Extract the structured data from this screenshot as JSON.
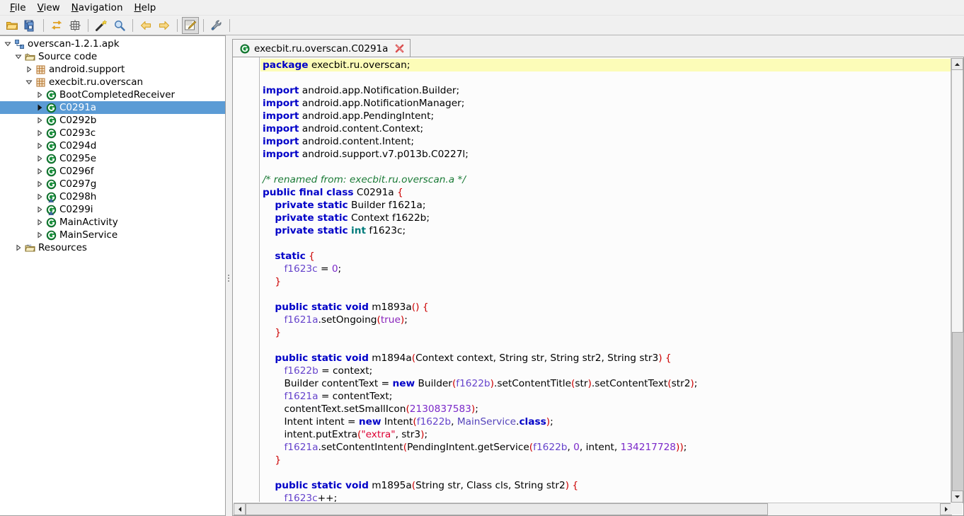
{
  "window": {
    "title": "overscan-1.2.1.apk"
  },
  "menubar": {
    "items": [
      {
        "mnemonic": "F",
        "rest": "ile",
        "name": "menu-file"
      },
      {
        "mnemonic": "V",
        "rest": "iew",
        "name": "menu-view"
      },
      {
        "mnemonic": "N",
        "rest": "avigation",
        "name": "menu-navigation"
      },
      {
        "mnemonic": "H",
        "rest": "elp",
        "name": "menu-help"
      }
    ]
  },
  "toolbar": {
    "buttons": [
      {
        "icon": "open-folder-icon",
        "active": false
      },
      {
        "icon": "save-all-icon",
        "active": false
      },
      {
        "sep": true
      },
      {
        "icon": "sort-arrows-icon",
        "active": false
      },
      {
        "icon": "grid-icon",
        "active": false
      },
      {
        "sep": true
      },
      {
        "icon": "magic-wand-icon",
        "active": false
      },
      {
        "icon": "search-magnifier-icon",
        "active": false
      },
      {
        "sep": true
      },
      {
        "icon": "back-arrow-icon",
        "active": false
      },
      {
        "icon": "forward-arrow-icon",
        "active": false
      },
      {
        "sep": true
      },
      {
        "icon": "edit-pencil-icon",
        "active": true
      },
      {
        "sep": true
      },
      {
        "icon": "wrench-icon",
        "active": false
      },
      {
        "sep": true
      }
    ]
  },
  "tree": {
    "items": [
      {
        "label": "overscan-1.2.1.apk",
        "indent": 0,
        "twisty": "open",
        "icon": "apk-icon",
        "selected": false
      },
      {
        "label": "Source code",
        "indent": 1,
        "twisty": "open",
        "icon": "sources-icon",
        "selected": false
      },
      {
        "label": "android.support",
        "indent": 2,
        "twisty": "closed",
        "icon": "package-icon",
        "selected": false
      },
      {
        "label": "execbit.ru.overscan",
        "indent": 2,
        "twisty": "open",
        "icon": "package-icon",
        "selected": false
      },
      {
        "label": "BootCompletedReceiver",
        "indent": 3,
        "twisty": "closed",
        "icon": "class-icon",
        "selected": false
      },
      {
        "label": "C0291a",
        "indent": 3,
        "twisty": "closed",
        "icon": "class-icon",
        "selected": true
      },
      {
        "label": "C0292b",
        "indent": 3,
        "twisty": "closed",
        "icon": "class-icon",
        "selected": false
      },
      {
        "label": "C0293c",
        "indent": 3,
        "twisty": "closed",
        "icon": "class-icon",
        "selected": false
      },
      {
        "label": "C0294d",
        "indent": 3,
        "twisty": "closed",
        "icon": "class-icon",
        "selected": false
      },
      {
        "label": "C0295e",
        "indent": 3,
        "twisty": "closed",
        "icon": "class-icon",
        "selected": false
      },
      {
        "label": "C0296f",
        "indent": 3,
        "twisty": "closed",
        "icon": "class-icon",
        "selected": false
      },
      {
        "label": "C0297g",
        "indent": 3,
        "twisty": "closed",
        "icon": "class-icon",
        "selected": false
      },
      {
        "label": "C0298h",
        "indent": 3,
        "twisty": "closed",
        "icon": "inner-class-icon",
        "selected": false
      },
      {
        "label": "C0299i",
        "indent": 3,
        "twisty": "closed",
        "icon": "inner-class-icon",
        "selected": false
      },
      {
        "label": "MainActivity",
        "indent": 3,
        "twisty": "closed",
        "icon": "class-icon",
        "selected": false
      },
      {
        "label": "MainService",
        "indent": 3,
        "twisty": "closed",
        "icon": "class-icon",
        "selected": false
      },
      {
        "label": "Resources",
        "indent": 1,
        "twisty": "closed",
        "icon": "resources-icon",
        "selected": false
      }
    ]
  },
  "editor": {
    "tab": {
      "label": "execbit.ru.overscan.C0291a",
      "icon": "class-icon",
      "close_icon": "close-x-icon"
    },
    "lines": [
      {
        "highlight": true,
        "tokens": [
          {
            "t": "package",
            "c": "kw"
          },
          {
            "t": " execbit.ru.overscan;",
            "c": ""
          }
        ]
      },
      {
        "tokens": []
      },
      {
        "tokens": [
          {
            "t": "import",
            "c": "kw"
          },
          {
            "t": " android.app.Notification.Builder;",
            "c": ""
          }
        ]
      },
      {
        "tokens": [
          {
            "t": "import",
            "c": "kw"
          },
          {
            "t": " android.app.NotificationManager;",
            "c": ""
          }
        ]
      },
      {
        "tokens": [
          {
            "t": "import",
            "c": "kw"
          },
          {
            "t": " android.app.PendingIntent;",
            "c": ""
          }
        ]
      },
      {
        "tokens": [
          {
            "t": "import",
            "c": "kw"
          },
          {
            "t": " android.content.Context;",
            "c": ""
          }
        ]
      },
      {
        "tokens": [
          {
            "t": "import",
            "c": "kw"
          },
          {
            "t": " android.content.Intent;",
            "c": ""
          }
        ]
      },
      {
        "tokens": [
          {
            "t": "import",
            "c": "kw"
          },
          {
            "t": " android.support.v7.p013b.C0227l;",
            "c": ""
          }
        ]
      },
      {
        "tokens": []
      },
      {
        "tokens": [
          {
            "t": "/* renamed from: execbit.ru.overscan.a */",
            "c": "cmt"
          }
        ]
      },
      {
        "tokens": [
          {
            "t": "public final class",
            "c": "kw"
          },
          {
            "t": " C0291a ",
            "c": ""
          },
          {
            "t": "{",
            "c": "pnc"
          }
        ]
      },
      {
        "tokens": [
          {
            "t": "    ",
            "c": ""
          },
          {
            "t": "private static",
            "c": "kw"
          },
          {
            "t": " Builder f1621a;",
            "c": ""
          }
        ]
      },
      {
        "tokens": [
          {
            "t": "    ",
            "c": ""
          },
          {
            "t": "private static",
            "c": "kw"
          },
          {
            "t": " Context f1622b;",
            "c": ""
          }
        ]
      },
      {
        "tokens": [
          {
            "t": "    ",
            "c": ""
          },
          {
            "t": "private static",
            "c": "kw"
          },
          {
            "t": " ",
            "c": ""
          },
          {
            "t": "int",
            "c": "typ"
          },
          {
            "t": " f1623c;",
            "c": ""
          }
        ]
      },
      {
        "tokens": []
      },
      {
        "tokens": [
          {
            "t": "    ",
            "c": ""
          },
          {
            "t": "static",
            "c": "kw"
          },
          {
            "t": " ",
            "c": ""
          },
          {
            "t": "{",
            "c": "pnc"
          }
        ]
      },
      {
        "tokens": [
          {
            "t": "       ",
            "c": ""
          },
          {
            "t": "f1623c",
            "c": "fld"
          },
          {
            "t": " = ",
            "c": ""
          },
          {
            "t": "0",
            "c": "num"
          },
          {
            "t": ";",
            "c": ""
          }
        ]
      },
      {
        "tokens": [
          {
            "t": "    ",
            "c": ""
          },
          {
            "t": "}",
            "c": "pnc"
          }
        ]
      },
      {
        "tokens": []
      },
      {
        "tokens": [
          {
            "t": "    ",
            "c": ""
          },
          {
            "t": "public static void",
            "c": "kw"
          },
          {
            "t": " m1893a",
            "c": ""
          },
          {
            "t": "()",
            "c": "pnc"
          },
          {
            "t": " ",
            "c": ""
          },
          {
            "t": "{",
            "c": "pnc"
          }
        ]
      },
      {
        "tokens": [
          {
            "t": "       ",
            "c": ""
          },
          {
            "t": "f1621a",
            "c": "fld"
          },
          {
            "t": ".setOngoing",
            "c": ""
          },
          {
            "t": "(",
            "c": "pnc"
          },
          {
            "t": "true",
            "c": "lit"
          },
          {
            "t": ")",
            "c": "pnc"
          },
          {
            "t": ";",
            "c": ""
          }
        ]
      },
      {
        "tokens": [
          {
            "t": "    ",
            "c": ""
          },
          {
            "t": "}",
            "c": "pnc"
          }
        ]
      },
      {
        "tokens": []
      },
      {
        "tokens": [
          {
            "t": "    ",
            "c": ""
          },
          {
            "t": "public static void",
            "c": "kw"
          },
          {
            "t": " m1894a",
            "c": ""
          },
          {
            "t": "(",
            "c": "pnc"
          },
          {
            "t": "Context context, String str, String str2, String str3",
            "c": ""
          },
          {
            "t": ")",
            "c": "pnc"
          },
          {
            "t": " ",
            "c": ""
          },
          {
            "t": "{",
            "c": "pnc"
          }
        ]
      },
      {
        "tokens": [
          {
            "t": "       ",
            "c": ""
          },
          {
            "t": "f1622b",
            "c": "fld"
          },
          {
            "t": " = context;",
            "c": ""
          }
        ]
      },
      {
        "tokens": [
          {
            "t": "       Builder contentText = ",
            "c": ""
          },
          {
            "t": "new",
            "c": "kw"
          },
          {
            "t": " Builder",
            "c": ""
          },
          {
            "t": "(",
            "c": "pnc"
          },
          {
            "t": "f1622b",
            "c": "fld"
          },
          {
            "t": ")",
            "c": "pnc"
          },
          {
            "t": ".setContentTitle",
            "c": ""
          },
          {
            "t": "(",
            "c": "pnc"
          },
          {
            "t": "str",
            "c": ""
          },
          {
            "t": ")",
            "c": "pnc"
          },
          {
            "t": ".setContentText",
            "c": ""
          },
          {
            "t": "(",
            "c": "pnc"
          },
          {
            "t": "str2",
            "c": ""
          },
          {
            "t": ")",
            "c": "pnc"
          },
          {
            "t": ";",
            "c": ""
          }
        ]
      },
      {
        "tokens": [
          {
            "t": "       ",
            "c": ""
          },
          {
            "t": "f1621a",
            "c": "fld"
          },
          {
            "t": " = contentText;",
            "c": ""
          }
        ]
      },
      {
        "tokens": [
          {
            "t": "       contentText.setSmallIcon",
            "c": ""
          },
          {
            "t": "(",
            "c": "pnc"
          },
          {
            "t": "2130837583",
            "c": "num"
          },
          {
            "t": ")",
            "c": "pnc"
          },
          {
            "t": ";",
            "c": ""
          }
        ]
      },
      {
        "tokens": [
          {
            "t": "       Intent intent = ",
            "c": ""
          },
          {
            "t": "new",
            "c": "kw"
          },
          {
            "t": " Intent",
            "c": ""
          },
          {
            "t": "(",
            "c": "pnc"
          },
          {
            "t": "f1622b",
            "c": "fld"
          },
          {
            "t": ", ",
            "c": ""
          },
          {
            "t": "MainService",
            "c": "cls2"
          },
          {
            "t": ".",
            "c": ""
          },
          {
            "t": "class",
            "c": "kw"
          },
          {
            "t": ")",
            "c": "pnc"
          },
          {
            "t": ";",
            "c": ""
          }
        ]
      },
      {
        "tokens": [
          {
            "t": "       intent.putExtra",
            "c": ""
          },
          {
            "t": "(",
            "c": "pnc"
          },
          {
            "t": "\"extra\"",
            "c": "str"
          },
          {
            "t": ", str3",
            "c": ""
          },
          {
            "t": ")",
            "c": "pnc"
          },
          {
            "t": ";",
            "c": ""
          }
        ]
      },
      {
        "tokens": [
          {
            "t": "       ",
            "c": ""
          },
          {
            "t": "f1621a",
            "c": "fld"
          },
          {
            "t": ".setContentIntent",
            "c": ""
          },
          {
            "t": "(",
            "c": "pnc"
          },
          {
            "t": "PendingIntent.getService",
            "c": ""
          },
          {
            "t": "(",
            "c": "pnc"
          },
          {
            "t": "f1622b",
            "c": "fld"
          },
          {
            "t": ", ",
            "c": ""
          },
          {
            "t": "0",
            "c": "num"
          },
          {
            "t": ", intent, ",
            "c": ""
          },
          {
            "t": "134217728",
            "c": "num"
          },
          {
            "t": "))",
            "c": "pnc"
          },
          {
            "t": ";",
            "c": ""
          }
        ]
      },
      {
        "tokens": [
          {
            "t": "    ",
            "c": ""
          },
          {
            "t": "}",
            "c": "pnc"
          }
        ]
      },
      {
        "tokens": []
      },
      {
        "tokens": [
          {
            "t": "    ",
            "c": ""
          },
          {
            "t": "public static void",
            "c": "kw"
          },
          {
            "t": " m1895a",
            "c": ""
          },
          {
            "t": "(",
            "c": "pnc"
          },
          {
            "t": "String str, Class cls, String str2",
            "c": ""
          },
          {
            "t": ")",
            "c": "pnc"
          },
          {
            "t": " ",
            "c": ""
          },
          {
            "t": "{",
            "c": "pnc"
          }
        ]
      },
      {
        "tokens": [
          {
            "t": "       ",
            "c": ""
          },
          {
            "t": "f1623c",
            "c": "fld"
          },
          {
            "t": "++;",
            "c": ""
          }
        ]
      }
    ]
  },
  "scrollbars": {
    "vertical": {
      "up_icon": "scroll-up-icon",
      "down_icon": "scroll-down-icon"
    },
    "horizontal": {
      "left_icon": "scroll-left-icon",
      "right_icon": "scroll-right-icon"
    }
  },
  "colors": {
    "selection": "#5b9bd5",
    "highlight_line": "#fcfcb8",
    "keyword": "#0000c8",
    "comment": "#1a7a36",
    "string": "#dd0033",
    "number": "#7b29c9",
    "punctuation": "#cc0000",
    "type": "#007b7b"
  }
}
